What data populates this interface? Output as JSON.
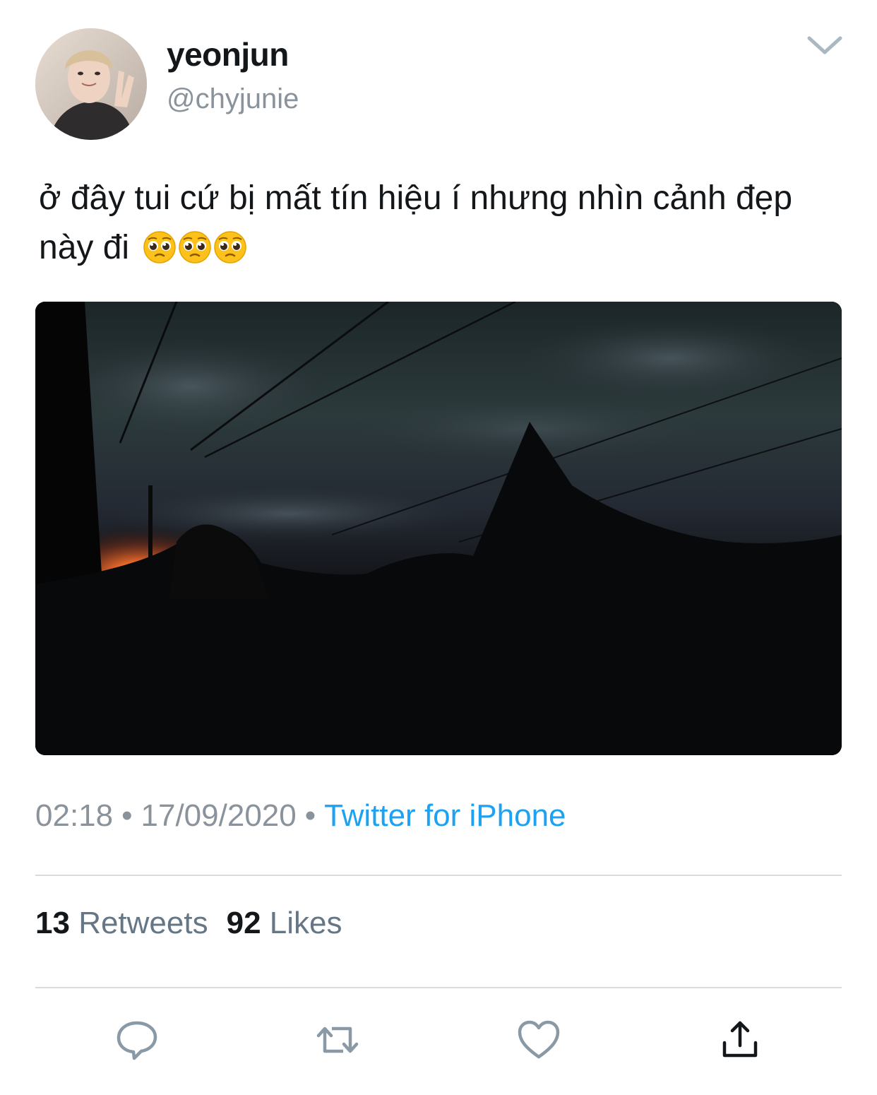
{
  "author": {
    "display_name": "yeonjun",
    "handle": "@chyjunie"
  },
  "tweet": {
    "text": "ở đây tui cứ bị mất tín hiệu í nhưng nhìn cảnh đẹp này đi",
    "emojis": [
      "pleading-face",
      "pleading-face",
      "pleading-face"
    ]
  },
  "meta": {
    "time": "02:18",
    "separator": "•",
    "date": "17/09/2020",
    "source": "Twitter for iPhone"
  },
  "stats": {
    "retweets_count": "13",
    "retweets_label": "Retweets",
    "likes_count": "92",
    "likes_label": "Likes"
  },
  "actions": [
    "reply-icon",
    "retweet-icon",
    "like-icon",
    "share-icon"
  ],
  "colors": {
    "link": "#1da1f2",
    "secondary_text": "#8a939b",
    "primary_text": "#14171a",
    "divider": "#d6dbdf"
  }
}
